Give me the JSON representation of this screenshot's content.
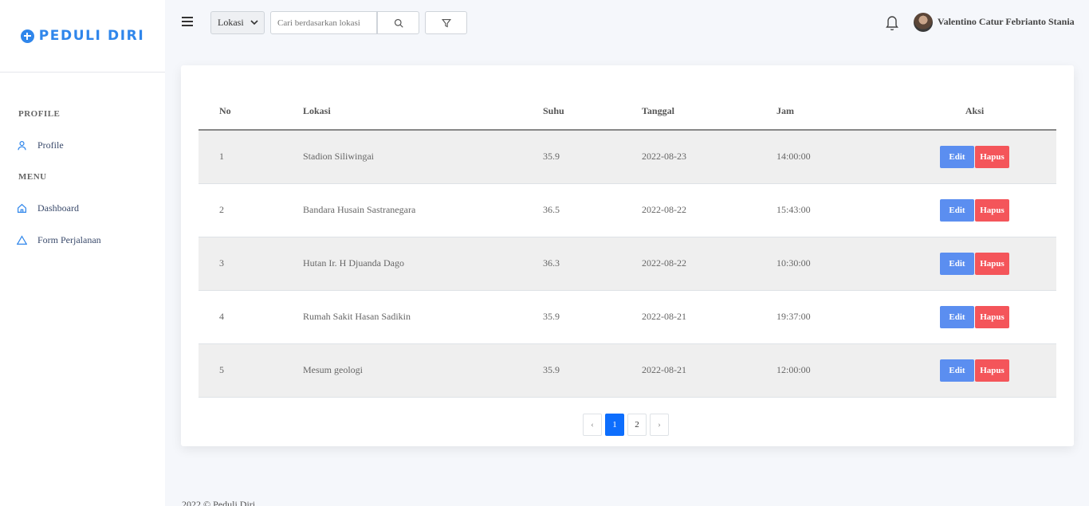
{
  "brand": {
    "name": "PEDULI DIRI",
    "color": "#2f86eb"
  },
  "sidebar": {
    "sections": [
      {
        "title": "PROFILE",
        "items": [
          {
            "label": "Profile",
            "icon": "user-icon"
          }
        ]
      },
      {
        "title": "MENU",
        "items": [
          {
            "label": "Dashboard",
            "icon": "home-icon"
          },
          {
            "label": "Form Perjalanan",
            "icon": "triangle-icon"
          }
        ]
      }
    ]
  },
  "topbar": {
    "filter_select": {
      "value": "Lokasi"
    },
    "search": {
      "placeholder": "Cari berdasarkan lokasi",
      "value": ""
    },
    "user_name": "Valentino Catur Febrianto Stania"
  },
  "table": {
    "headers": {
      "no": "No",
      "lokasi": "Lokasi",
      "suhu": "Suhu",
      "tanggal": "Tanggal",
      "jam": "Jam",
      "aksi": "Aksi"
    },
    "rows": [
      {
        "no": "1",
        "lokasi": "Stadion Siliwingai",
        "suhu": "35.9",
        "tanggal": "2022-08-23",
        "jam": "14:00:00"
      },
      {
        "no": "2",
        "lokasi": "Bandara Husain Sastranegara",
        "suhu": "36.5",
        "tanggal": "2022-08-22",
        "jam": "15:43:00"
      },
      {
        "no": "3",
        "lokasi": "Hutan Ir. H Djuanda Dago",
        "suhu": "36.3",
        "tanggal": "2022-08-22",
        "jam": "10:30:00"
      },
      {
        "no": "4",
        "lokasi": "Rumah Sakit Hasan Sadikin",
        "suhu": "35.9",
        "tanggal": "2022-08-21",
        "jam": "19:37:00"
      },
      {
        "no": "5",
        "lokasi": "Mesum geologi",
        "suhu": "35.9",
        "tanggal": "2022-08-21",
        "jam": "12:00:00"
      }
    ],
    "edit_label": "Edit",
    "delete_label": "Hapus",
    "edit_color": "#5b8ef0",
    "delete_color": "#f4555a"
  },
  "pagination": {
    "prev": "‹",
    "pages": [
      "1",
      "2"
    ],
    "current": "1",
    "next": "›"
  },
  "footer": {
    "text": "2022 © Peduli Diri"
  }
}
